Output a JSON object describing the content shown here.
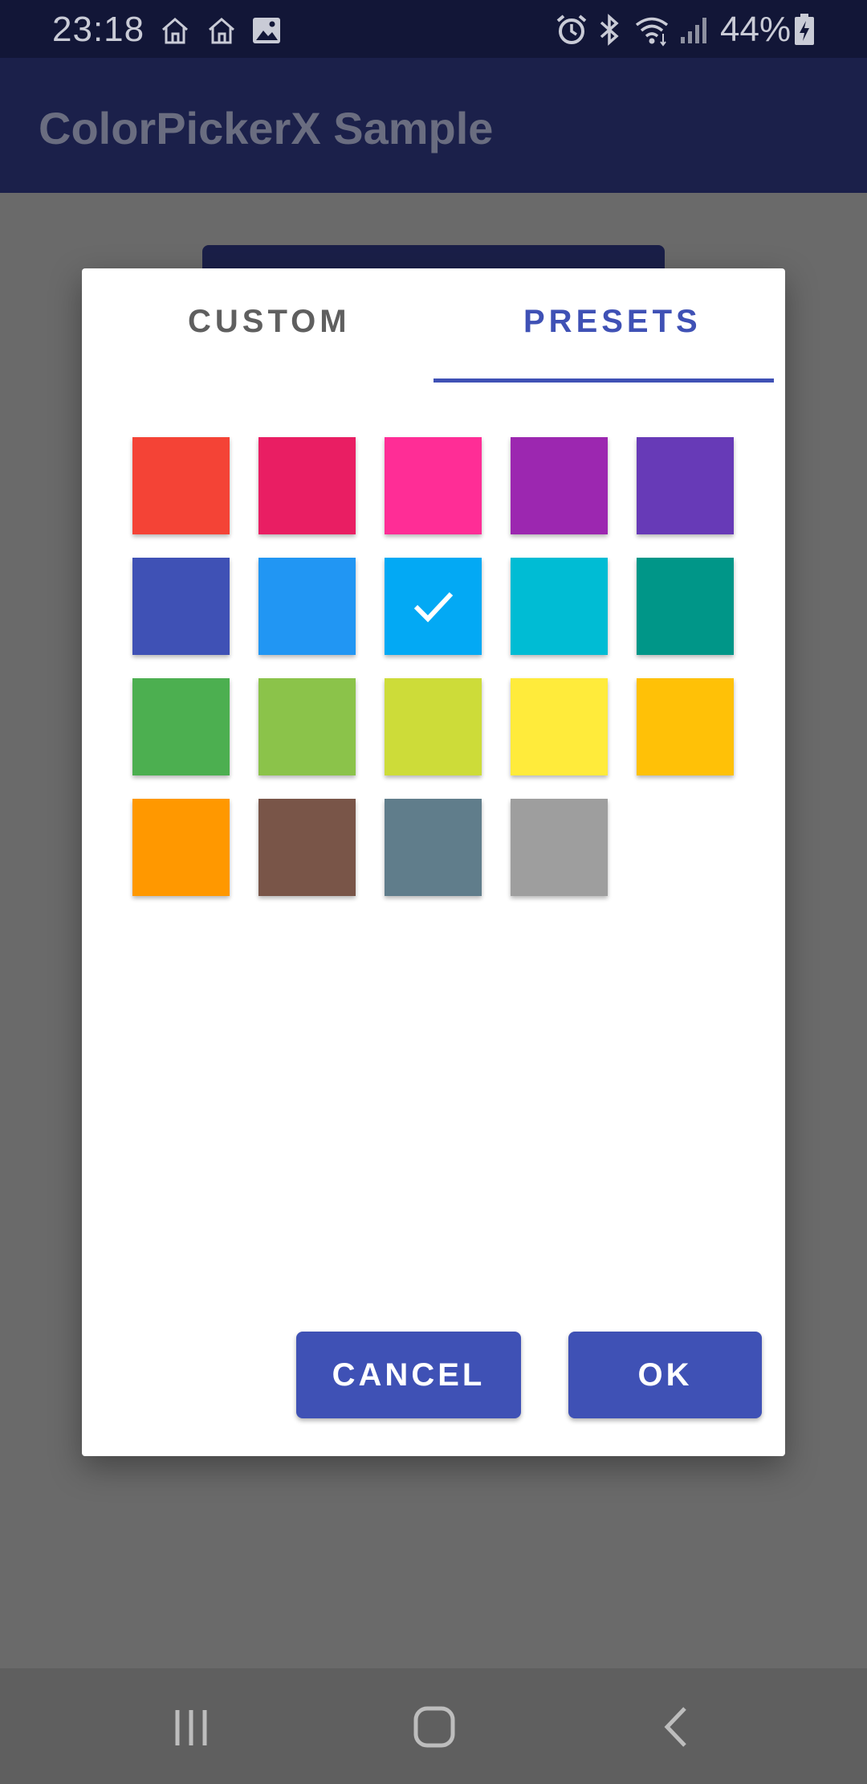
{
  "status_bar": {
    "time": "23:18",
    "battery": "44%",
    "icons": [
      "home-icon",
      "home-icon",
      "image-icon",
      "alarm-icon",
      "bluetooth-icon",
      "wifi-icon",
      "signal-icon",
      "battery-charging-icon"
    ]
  },
  "app_bar": {
    "title": "ColorPickerX Sample"
  },
  "dialog": {
    "tabs": [
      {
        "label": "CUSTOM",
        "selected": false
      },
      {
        "label": "PRESETS",
        "selected": true
      }
    ],
    "swatches": [
      {
        "color": "#F44336"
      },
      {
        "color": "#E91E63"
      },
      {
        "color": "#FF2D96"
      },
      {
        "color": "#9C27B0"
      },
      {
        "color": "#673AB7"
      },
      {
        "color": "#3F51B5"
      },
      {
        "color": "#2196F3"
      },
      {
        "color": "#03A9F4",
        "selected": true
      },
      {
        "color": "#00BCD4"
      },
      {
        "color": "#009688"
      },
      {
        "color": "#4CAF50"
      },
      {
        "color": "#8BC34A"
      },
      {
        "color": "#CDDC39"
      },
      {
        "color": "#FFEB3B"
      },
      {
        "color": "#FFC107"
      },
      {
        "color": "#FF9800"
      },
      {
        "color": "#795548"
      },
      {
        "color": "#607D8B"
      },
      {
        "color": "#9E9E9E"
      }
    ],
    "selected_icon": "check-icon",
    "cancel_label": "CANCEL",
    "ok_label": "OK"
  },
  "nav_bar": {
    "icons": [
      "recent-apps-icon",
      "home-icon",
      "back-icon"
    ]
  },
  "colors": {
    "accent": "#3F51B5",
    "app_bar": "#1B204A",
    "status_bar": "#121637",
    "scrim": "#6A6A6A"
  }
}
